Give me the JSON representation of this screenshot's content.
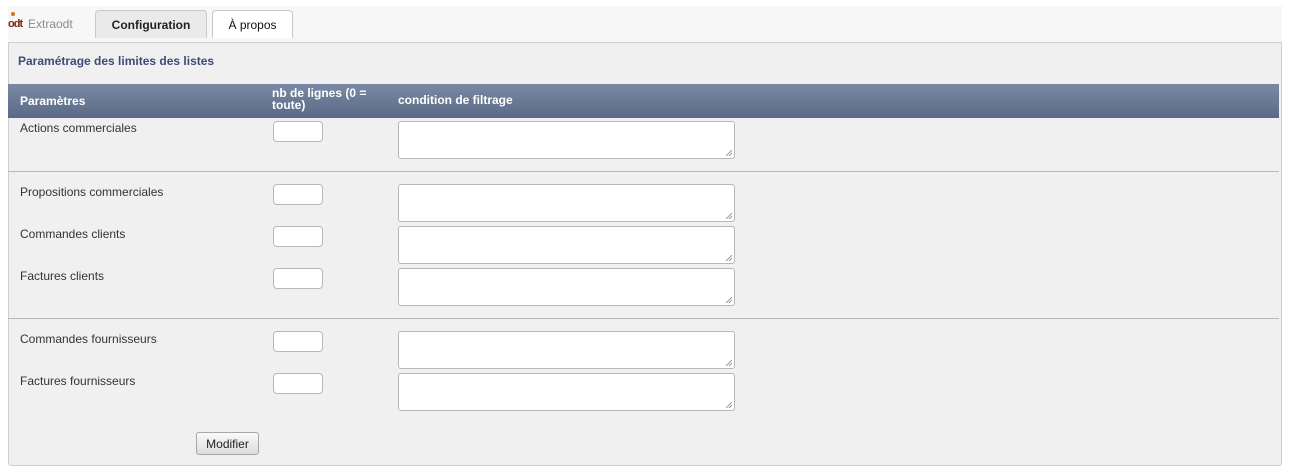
{
  "tabs": {
    "logo_text": "Extraodt",
    "logo_glyph": "odt",
    "configuration": "Configuration",
    "about": "À propos"
  },
  "panel": {
    "title": "Paramétrage des limites des listes"
  },
  "table": {
    "headers": {
      "params": "Paramètres",
      "nb_lines": "nb de lignes (0 = toute)",
      "condition": "condition de filtrage"
    },
    "rows": [
      {
        "label": "Actions commerciales",
        "nb": "",
        "condition": ""
      },
      {
        "label": "Propositions commerciales",
        "nb": "",
        "condition": ""
      },
      {
        "label": "Commandes clients",
        "nb": "",
        "condition": ""
      },
      {
        "label": "Factures clients",
        "nb": "",
        "condition": ""
      },
      {
        "label": "Commandes fournisseurs",
        "nb": "",
        "condition": ""
      },
      {
        "label": "Factures fournisseurs",
        "nb": "",
        "condition": ""
      }
    ]
  },
  "actions": {
    "modify": "Modifier"
  },
  "colors": {
    "header_bg": "#6a7a96",
    "title": "#3e4a7a",
    "panel_bg": "#f0f0f0"
  }
}
